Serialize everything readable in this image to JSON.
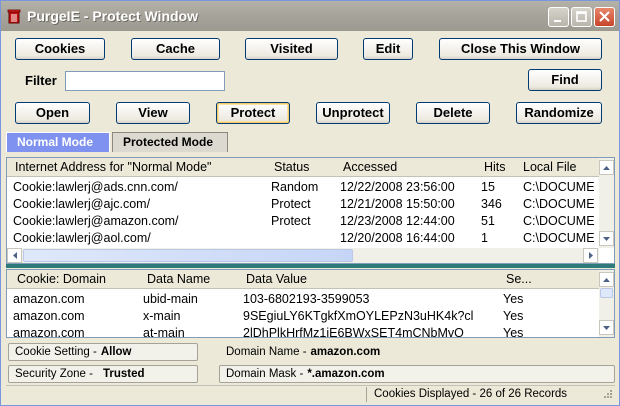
{
  "window": {
    "title": "PurgeIE - Protect Window",
    "icon": "trash-can-icon"
  },
  "buttons_row1": {
    "cookies": "Cookies",
    "cache": "Cache",
    "visited": "Visited",
    "edit": "Edit",
    "close_window": "Close This Window"
  },
  "filter": {
    "label": "Filter",
    "value": "",
    "find": "Find"
  },
  "buttons_row2": {
    "open": "Open",
    "view": "View",
    "protect": "Protect",
    "unprotect": "Unprotect",
    "delete": "Delete",
    "randomize": "Randomize"
  },
  "tabs": {
    "normal": "Normal Mode",
    "protected": "Protected Mode",
    "active": "normal"
  },
  "top_list": {
    "columns": [
      "Internet Address for \"Normal Mode\"",
      "Status",
      "Accessed",
      "Hits",
      "Local File"
    ],
    "rows": [
      {
        "address": "Cookie:lawlerj@ads.cnn.com/",
        "status": "Random",
        "accessed": "12/22/2008 23:56:00",
        "hits": "15",
        "file": "C:\\DOCUME"
      },
      {
        "address": "Cookie:lawlerj@ajc.com/",
        "status": "Protect",
        "accessed": "12/21/2008 15:50:00",
        "hits": "346",
        "file": "C:\\DOCUME"
      },
      {
        "address": "Cookie:lawlerj@amazon.com/",
        "status": "Protect",
        "accessed": "12/23/2008 12:44:00",
        "hits": "51",
        "file": "C:\\DOCUME"
      },
      {
        "address": "Cookie:lawlerj@aol.com/",
        "status": "",
        "accessed": "12/20/2008 16:44:00",
        "hits": "1",
        "file": "C:\\DOCUME"
      }
    ]
  },
  "bottom_list": {
    "columns": [
      "Cookie:  Domain",
      "Data Name",
      "Data Value",
      "Se..."
    ],
    "rows": [
      {
        "domain": "amazon.com",
        "name": "ubid-main",
        "value": "103-6802193-3599053",
        "secure": "Yes"
      },
      {
        "domain": "amazon.com",
        "name": "x-main",
        "value": "9SEgiuLY6KTgkfXmOYLEPzN3uHK4k?cl",
        "secure": "Yes"
      },
      {
        "domain": "amazon.com",
        "name": "at-main",
        "value": "2lDhPlkHrfMz1iE6BWxSET4mCNbMvQ",
        "secure": "Yes"
      }
    ]
  },
  "info": {
    "cookie_setting_label": "Cookie Setting -",
    "cookie_setting_value": "Allow",
    "security_zone_label": "Security Zone -",
    "security_zone_value": "Trusted",
    "domain_name_label": "Domain Name -",
    "domain_name_value": "amazon.com",
    "domain_mask_label": "Domain Mask -",
    "domain_mask_value": "*.amazon.com"
  },
  "status_bar": {
    "text": "Cookies Displayed - 26 of 26 Records"
  },
  "colors": {
    "tab_active": "#7f92ef",
    "divider": "#2e7a7a",
    "titlebar": "#a6a49a"
  }
}
